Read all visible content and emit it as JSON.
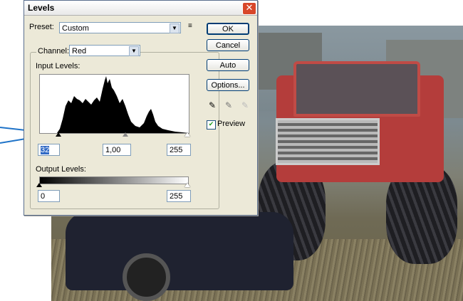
{
  "dialog": {
    "title": "Levels",
    "close_glyph": "✕",
    "preset_label": "Preset:",
    "preset_value": "Custom",
    "channel_label": "Channel:",
    "channel_value": "Red",
    "input_levels_label": "Input Levels:",
    "input_black": "32",
    "input_gamma": "1,00",
    "input_white": "255",
    "output_levels_label": "Output Levels:",
    "output_black": "0",
    "output_white": "255",
    "preview_label": "Preview",
    "preview_checked": true
  },
  "buttons": {
    "ok": "OK",
    "cancel": "Cancel",
    "auto": "Auto",
    "options": "Options..."
  },
  "icons": {
    "preset_menu": "list-menu-icon",
    "dropdown": "chevron-down-icon",
    "eyedroppers": [
      "black-eyedropper-icon",
      "gray-eyedropper-icon",
      "white-eyedropper-icon"
    ],
    "annotation": "arrow-icon"
  },
  "colors": {
    "dialog_bg": "#ece9d8",
    "close_red": "#d8472a",
    "arrow_blue": "#1f73c8",
    "histogram": "#000000"
  }
}
